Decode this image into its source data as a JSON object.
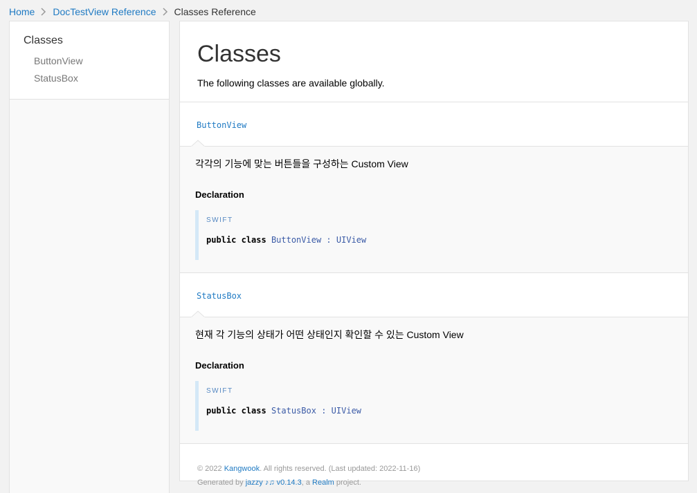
{
  "breadcrumbs": {
    "home": "Home",
    "reference": "DocTestView Reference",
    "current": "Classes Reference"
  },
  "sidebar": {
    "title": "Classes",
    "items": [
      {
        "label": "ButtonView"
      },
      {
        "label": "StatusBox"
      }
    ]
  },
  "main": {
    "title": "Classes",
    "subtitle": "The following classes are available globally.",
    "items": [
      {
        "name": "ButtonView",
        "abstract": "각각의 기능에 맞는 버튼들을 구성하는 Custom View",
        "declaration_label": "Declaration",
        "language": "SWIFT",
        "code_keywords": "public class",
        "code_name": "ButtonView",
        "code_sep": ":",
        "code_super": "UIView"
      },
      {
        "name": "StatusBox",
        "abstract": "현재 각 기능의 상태가 어떤 상태인지 확인할 수 있는 Custom View",
        "declaration_label": "Declaration",
        "language": "SWIFT",
        "code_keywords": "public class",
        "code_name": "StatusBox",
        "code_sep": ":",
        "code_super": "UIView"
      }
    ]
  },
  "footer": {
    "copyright_prefix": "© 2022 ",
    "author": "Kangwook",
    "copyright_suffix": ". All rights reserved. (Last updated: 2022-11-16)",
    "generated_prefix": "Generated by ",
    "generator": "jazzy ♪♫ v0.14.3",
    "generated_mid": ", a ",
    "org": "Realm",
    "generated_suffix": " project."
  },
  "colors": {
    "link": "#1f7ac3",
    "declaration_bar": "#d4e8f7",
    "background": "#f2f2f2"
  }
}
